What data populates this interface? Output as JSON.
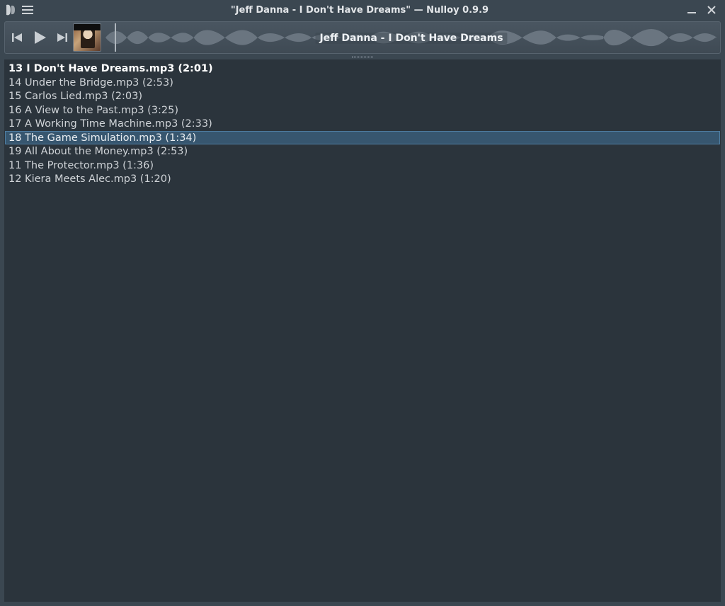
{
  "window": {
    "title": "\"Jeff Danna - I Don't Have Dreams\" — Nulloy 0.9.9"
  },
  "player": {
    "now_playing": "Jeff Danna - I Don't Have Dreams",
    "playhead_pct": 1.5
  },
  "playlist": {
    "items": [
      {
        "text": "13 I Don't Have Dreams.mp3 (2:01)",
        "current": true,
        "selected": false
      },
      {
        "text": "14 Under the Bridge.mp3 (2:53)",
        "current": false,
        "selected": false
      },
      {
        "text": "15 Carlos Lied.mp3 (2:03)",
        "current": false,
        "selected": false
      },
      {
        "text": "16 A View to the Past.mp3 (3:25)",
        "current": false,
        "selected": false
      },
      {
        "text": "17 A Working Time Machine.mp3 (2:33)",
        "current": false,
        "selected": false
      },
      {
        "text": "18 The Game Simulation.mp3 (1:34)",
        "current": false,
        "selected": true
      },
      {
        "text": "19 All About the Money.mp3 (2:53)",
        "current": false,
        "selected": false
      },
      {
        "text": "11 The Protector.mp3 (1:36)",
        "current": false,
        "selected": false
      },
      {
        "text": "12 Kiera Meets Alec.mp3 (1:20)",
        "current": false,
        "selected": false
      }
    ]
  }
}
